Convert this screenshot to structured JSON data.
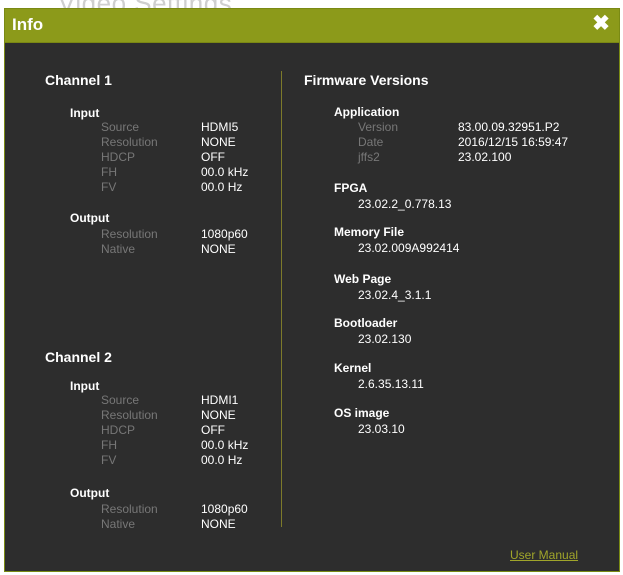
{
  "background": {
    "text": "Video Settings"
  },
  "dialog": {
    "title": "Info",
    "close_glyph": "✖"
  },
  "channel1": {
    "title": "Channel 1",
    "input": {
      "label": "Input",
      "rows": [
        {
          "label": "Source",
          "value": "HDMI5"
        },
        {
          "label": "Resolution",
          "value": "NONE"
        },
        {
          "label": "HDCP",
          "value": "OFF"
        },
        {
          "label": "FH",
          "value": "00.0 kHz"
        },
        {
          "label": "FV",
          "value": "00.0 Hz"
        }
      ]
    },
    "output": {
      "label": "Output",
      "rows": [
        {
          "label": "Resolution",
          "value": "1080p60"
        },
        {
          "label": "Native",
          "value": "NONE"
        }
      ]
    }
  },
  "channel2": {
    "title": "Channel 2",
    "input": {
      "label": "Input",
      "rows": [
        {
          "label": "Source",
          "value": "HDMI1"
        },
        {
          "label": "Resolution",
          "value": "NONE"
        },
        {
          "label": "HDCP",
          "value": "OFF"
        },
        {
          "label": "FH",
          "value": "00.0 kHz"
        },
        {
          "label": "FV",
          "value": "00.0 Hz"
        }
      ]
    },
    "output": {
      "label": "Output",
      "rows": [
        {
          "label": "Resolution",
          "value": "1080p60"
        },
        {
          "label": "Native",
          "value": "NONE"
        }
      ]
    }
  },
  "firmware": {
    "title": "Firmware Versions",
    "application": {
      "label": "Application",
      "rows": [
        {
          "label": "Version",
          "value": "83.00.09.32951.P2"
        },
        {
          "label": "Date",
          "value": "2016/12/15 16:59:47"
        },
        {
          "label": "jffs2",
          "value": "23.02.100"
        }
      ]
    },
    "components": [
      {
        "label": "FPGA",
        "value": "23.02.2_0.778.13"
      },
      {
        "label": "Memory File",
        "value": "23.02.009A992414"
      },
      {
        "label": "Web Page",
        "value": "23.02.4_3.1.1"
      },
      {
        "label": "Bootloader",
        "value": "23.02.130"
      },
      {
        "label": "Kernel",
        "value": "2.6.35.13.11"
      },
      {
        "label": "OS image",
        "value": "23.03.10"
      }
    ]
  },
  "footer": {
    "manual_link": "User Manual"
  },
  "colors": {
    "titlebar": "#8c9a1a",
    "panel": "#2d2d2d",
    "label_gray": "#777777",
    "link": "#a0a52a"
  }
}
